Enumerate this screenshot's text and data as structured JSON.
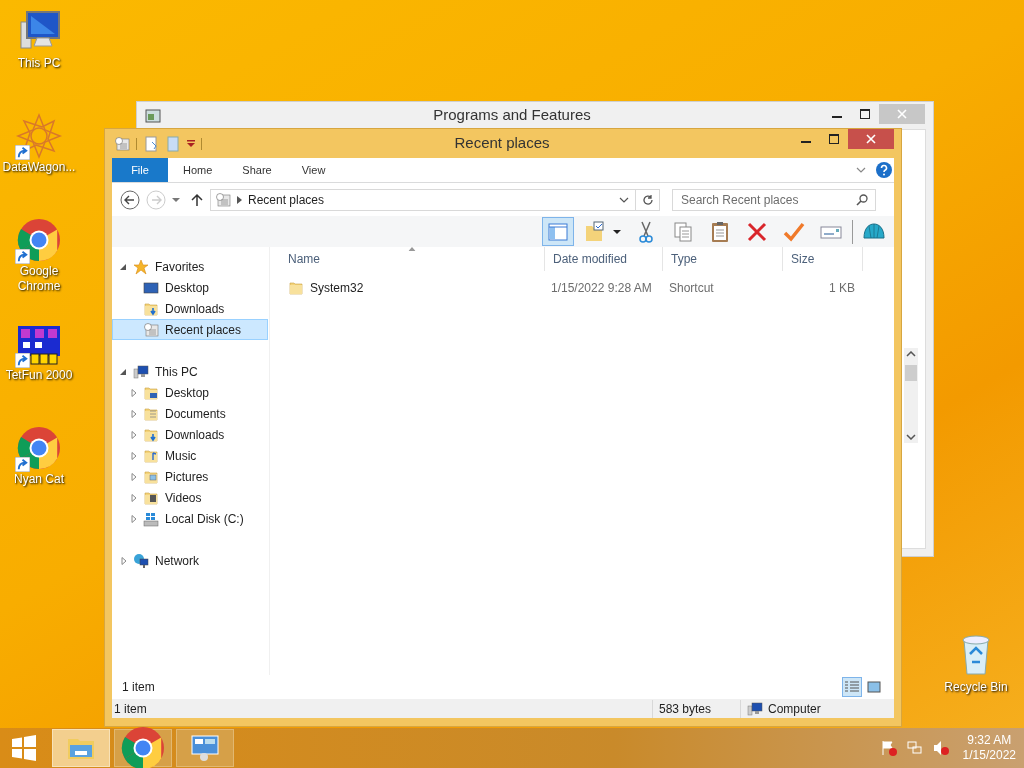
{
  "desktop_icons": [
    {
      "label": "This PC",
      "kind": "pc",
      "shortcut": false
    },
    {
      "label": "DataWagon...",
      "kind": "datawagon",
      "shortcut": true
    },
    {
      "label": "Google Chrome",
      "kind": "chrome",
      "shortcut": true
    },
    {
      "label": "TetFun 2000",
      "kind": "tetfun",
      "shortcut": true
    },
    {
      "label": "Nyan Cat",
      "kind": "chrome",
      "shortcut": true
    }
  ],
  "recycle_bin": {
    "label": "Recycle Bin"
  },
  "back_window": {
    "title": "Programs and Features"
  },
  "explorer": {
    "title": "Recent places",
    "ribbon_tabs": [
      {
        "label": "File",
        "kind": "file",
        "selected": false
      },
      {
        "label": "Home",
        "kind": "tab",
        "selected": false
      },
      {
        "label": "Share",
        "kind": "tab",
        "selected": false
      },
      {
        "label": "View",
        "kind": "tab",
        "selected": false
      }
    ],
    "address": {
      "path": "Recent places"
    },
    "search": {
      "placeholder": "Search Recent places"
    },
    "toolbar": [
      {
        "kind": "pane",
        "selected": true
      },
      {
        "kind": "folder-check",
        "selected": false
      },
      {
        "kind": "scissors",
        "selected": false
      },
      {
        "kind": "copy",
        "selected": false
      },
      {
        "kind": "paste",
        "selected": false
      },
      {
        "kind": "delete",
        "selected": false
      },
      {
        "kind": "check",
        "selected": false
      },
      {
        "kind": "rename",
        "selected": false
      },
      {
        "kind": "shell",
        "selected": false
      }
    ],
    "nav": [
      {
        "label": "Favorites",
        "kind": "star",
        "expanded": true,
        "children": [
          {
            "label": "Desktop",
            "kind": "desktop",
            "selected": false
          },
          {
            "label": "Downloads",
            "kind": "downloads",
            "selected": false
          },
          {
            "label": "Recent places",
            "kind": "recent",
            "selected": true
          }
        ]
      },
      {
        "label": "This PC",
        "kind": "pc",
        "expanded": true,
        "children": [
          {
            "label": "Desktop",
            "kind": "desktop-folder",
            "selected": false,
            "expanded": false
          },
          {
            "label": "Documents",
            "kind": "documents",
            "selected": false,
            "expanded": false
          },
          {
            "label": "Downloads",
            "kind": "downloads",
            "selected": false,
            "expanded": false
          },
          {
            "label": "Music",
            "kind": "music",
            "selected": false,
            "expanded": false
          },
          {
            "label": "Pictures",
            "kind": "pictures",
            "selected": false,
            "expanded": false
          },
          {
            "label": "Videos",
            "kind": "videos",
            "selected": false,
            "expanded": false
          },
          {
            "label": "Local Disk (C:)",
            "kind": "disk",
            "selected": false,
            "expanded": false
          }
        ]
      },
      {
        "label": "Network",
        "kind": "network",
        "expanded": false
      }
    ],
    "columns": [
      {
        "label": "Name",
        "sorted": true
      },
      {
        "label": "Date modified",
        "sorted": false
      },
      {
        "label": "Type",
        "sorted": false
      },
      {
        "label": "Size",
        "sorted": false
      }
    ],
    "rows": [
      {
        "name": "System32",
        "date": "1/15/2022 9:28 AM",
        "type": "Shortcut",
        "size": "1 KB",
        "selected": false
      }
    ],
    "item_count": "1 item",
    "views": [
      {
        "kind": "details",
        "selected": true
      },
      {
        "kind": "large",
        "selected": false
      }
    ],
    "status_bar": [
      "1 item",
      "583 bytes",
      "Computer"
    ]
  },
  "taskbar": {
    "apps": [
      {
        "kind": "explorer",
        "selected": true
      },
      {
        "kind": "chrome",
        "selected": false
      },
      {
        "kind": "control",
        "selected": false
      }
    ],
    "time": "9:32 AM",
    "date": "1/15/2022"
  }
}
